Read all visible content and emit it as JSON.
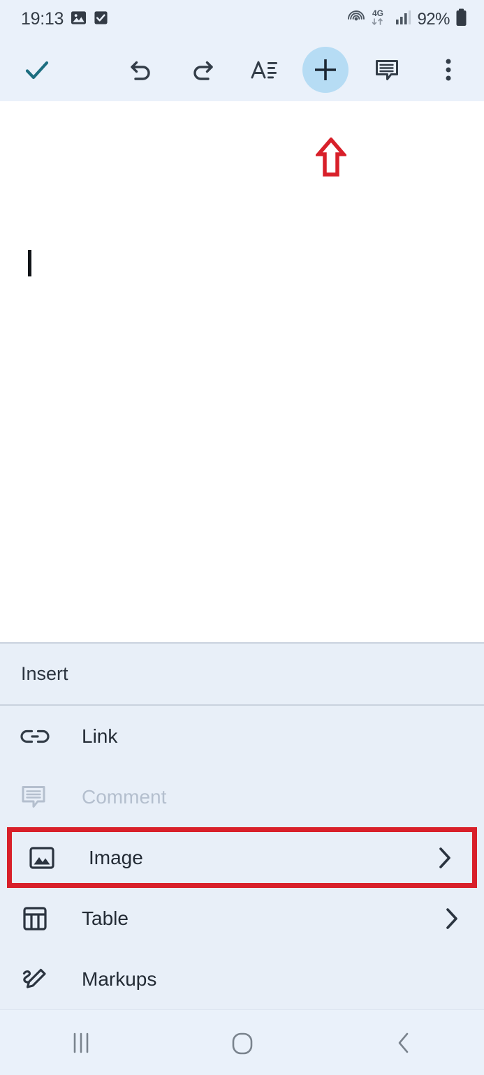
{
  "status_bar": {
    "clock": "19:13",
    "battery_percent": "92%",
    "network_type": "4G",
    "icons": [
      "image-notification-icon",
      "checkbox-notification-icon",
      "hotspot-icon",
      "mobile-data-4g-icon",
      "signal-bars-icon",
      "battery-icon"
    ]
  },
  "toolbar": {
    "done_label": "done-check",
    "undo_label": "undo",
    "redo_label": "redo",
    "format_label": "text-format",
    "insert_label": "insert-plus",
    "comment_label": "comment",
    "more_label": "more-options",
    "active_button": "insert-plus",
    "highlight_color": "#b6dcf4",
    "check_color": "#1d6e80",
    "icon_color": "#333d48",
    "background": "#eaf1fa"
  },
  "annotation": {
    "arrow_color": "#d8202a",
    "arrow_direction": "up",
    "highlight_box_color": "#d8202a",
    "highlight_target": "Image"
  },
  "document": {
    "content": "",
    "caret_visible": true,
    "background": "#ffffff"
  },
  "insert_panel": {
    "title": "Insert",
    "background": "#e8eff8",
    "items": [
      {
        "label": "Link",
        "icon": "link-icon",
        "has_chevron": false,
        "disabled": false,
        "highlighted": false
      },
      {
        "label": "Comment",
        "icon": "comment-icon",
        "has_chevron": false,
        "disabled": true,
        "highlighted": false
      },
      {
        "label": "Image",
        "icon": "image-icon",
        "has_chevron": true,
        "disabled": false,
        "highlighted": true
      },
      {
        "label": "Table",
        "icon": "table-icon",
        "has_chevron": true,
        "disabled": false,
        "highlighted": false
      },
      {
        "label": "Markups",
        "icon": "markups-icon",
        "has_chevron": false,
        "disabled": false,
        "highlighted": false
      }
    ]
  },
  "nav_bar": {
    "recents_label": "recents",
    "home_label": "home",
    "back_label": "back",
    "background": "#eaf1fa"
  }
}
